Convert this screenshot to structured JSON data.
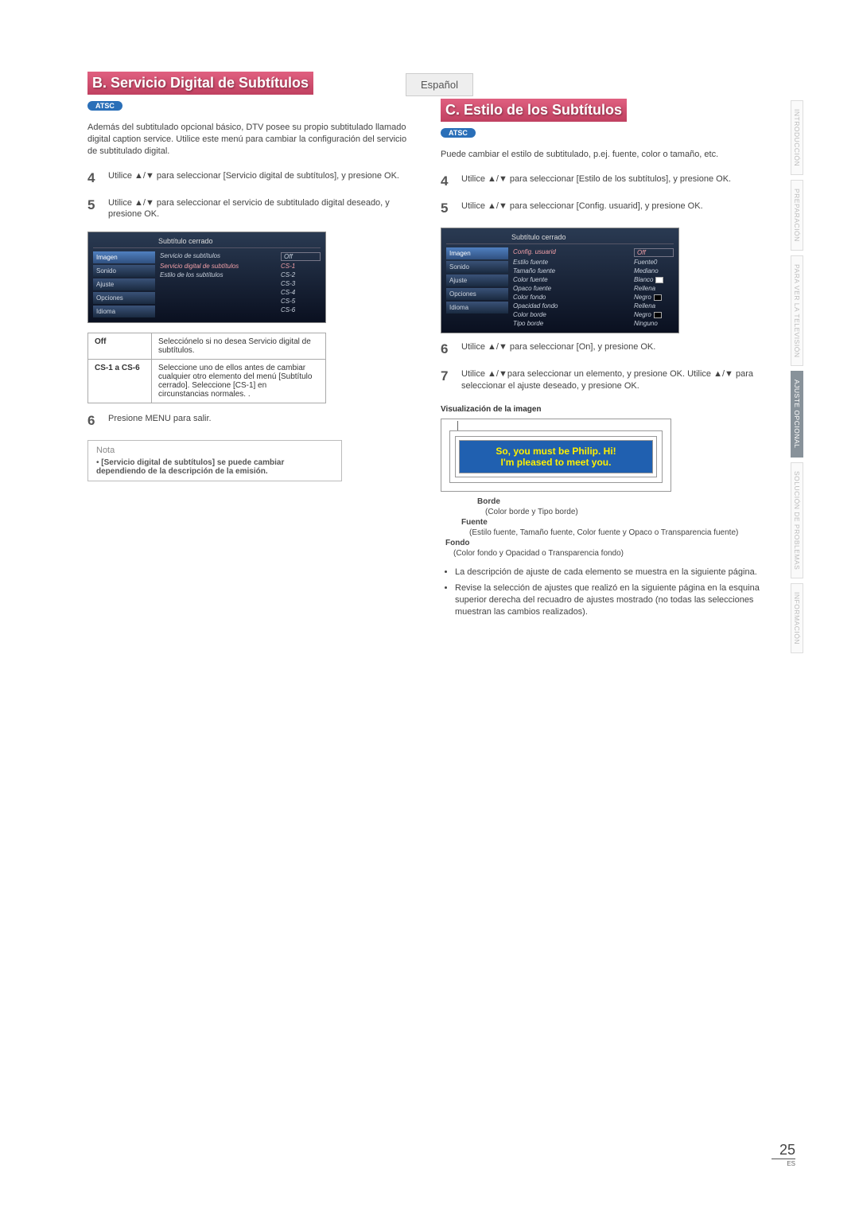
{
  "langTab": "Español",
  "page": {
    "num": "25",
    "suffix": "ES"
  },
  "sideTabs": [
    "INTRODUCCIÓN",
    "PREPARACIÓN",
    "PARA VER LA TELEVISIÓN",
    "AJUSTE OPCIONAL",
    "SOLUCIÓN DE PROBLEMAS",
    "INFORMACIÓN"
  ],
  "sideActive": 3,
  "secB": {
    "title": "B.  Servicio Digital de Subtítulos",
    "badge": "ATSC",
    "intro": "Además del subtitulado opcional básico, DTV posee su propio subtitulado llamado digital caption service. Utilice este menú para cambiar la configuración del servicio de subtitulado digital.",
    "steps": {
      "s4": "Utilice ▲/▼ para seleccionar [Servicio digital de subtítulos], y presione OK.",
      "s5": "Utilice ▲/▼ para seleccionar el servicio de subtitulado digital deseado, y presione OK."
    },
    "tv": {
      "title": "Subtítulo cerrado",
      "side": [
        "Imagen",
        "Sonido",
        "Ajuste",
        "Opciones",
        "Idioma"
      ],
      "rows": [
        {
          "lbl": "Servicio de subtítulos",
          "val": "Off",
          "box": true
        },
        {
          "lbl": "Servicio digital de subtítulos",
          "val": "CS-1",
          "hl": true
        },
        {
          "lbl": "Estilo de los subtítulos",
          "val": "CS-2"
        },
        {
          "lbl": "",
          "val": "CS-3"
        },
        {
          "lbl": "",
          "val": "CS-4"
        },
        {
          "lbl": "",
          "val": "CS-5"
        },
        {
          "lbl": "",
          "val": "CS-6"
        }
      ]
    },
    "defs": [
      {
        "k": "Off",
        "v": "Selecciónelo si no desea Servicio digital de subtítulos."
      },
      {
        "k": "CS-1 a CS-6",
        "v": "Seleccione uno de ellos antes de cambiar cualquier otro elemento del menú [Subtítulo cerrado]. Seleccione [CS-1] en circunstancias normales. ."
      }
    ],
    "step6": "Presione MENU para salir.",
    "nota": {
      "title": "Nota",
      "text": "[Servicio digital de subtítulos] se puede cambiar dependiendo de la descripción de la emisión."
    }
  },
  "secC": {
    "title": "C.  Estilo de los Subtítulos",
    "badge": "ATSC",
    "intro": "Puede cambiar el estilo de subtitulado, p.ej. fuente, color o tamaño, etc.",
    "steps": {
      "s4": "Utilice ▲/▼ para seleccionar [Estilo de los subtítulos], y presione OK.",
      "s5": "Utilice ▲/▼ para seleccionar [Config. usuarid], y presione OK."
    },
    "tv": {
      "title": "Subtítulo cerrado",
      "side": [
        "Imagen",
        "Sonido",
        "Ajuste",
        "Opciones",
        "Idioma"
      ],
      "rows": [
        {
          "lbl": "Config. usuarid",
          "val": "Off",
          "hl": true,
          "box": true
        },
        {
          "lbl": "Estilo fuente",
          "val": "Fuente0"
        },
        {
          "lbl": "Tamaño fuente",
          "val": "Mediano"
        },
        {
          "lbl": "Color fuente",
          "val": "Blanco",
          "sw": "#ffffff"
        },
        {
          "lbl": "Opaco fuente",
          "val": "Rellena"
        },
        {
          "lbl": "Color fondo",
          "val": "Negro",
          "sw": "#000000"
        },
        {
          "lbl": "Opacidad fondo",
          "val": "Rellena"
        },
        {
          "lbl": "Color borde",
          "val": "Negro",
          "sw": "#000000"
        },
        {
          "lbl": "Tipo borde",
          "val": "Ninguno"
        }
      ]
    },
    "step6": "Utilice ▲/▼ para seleccionar [On], y presione OK.",
    "step7": "Utilice ▲/▼para seleccionar un elemento, y presione OK. Utilice ▲/▼ para seleccionar el ajuste deseado, y presione OK.",
    "vis": {
      "heading": "Visualización de la imagen",
      "speech1": "So, you must be Philip. Hi!",
      "speech2": "I'm pleased to meet you.",
      "borde": "Borde",
      "bordeDesc": "(Color borde y Tipo borde)",
      "fuente": "Fuente",
      "fuenteDesc": "(Estilo fuente, Tamaño fuente, Color fuente y Opaco o Transparencia fuente)",
      "fondo": "Fondo",
      "fondoDesc": "(Color fondo y Opacidad o Transparencia fondo)"
    },
    "bullets": [
      "La descripción de ajuste de cada elemento se muestra en la siguiente página.",
      "Revise la selección de ajustes que realizó en la siguiente página en la esquina superior derecha del recuadro de ajustes mostrado (no todas las selecciones muestran las cambios realizados)."
    ]
  }
}
